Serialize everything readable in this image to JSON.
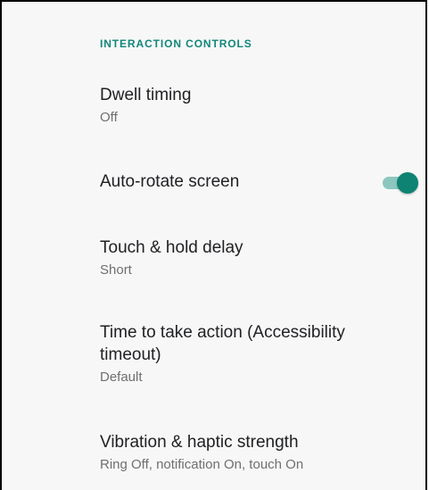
{
  "section": {
    "header": "INTERACTION CONTROLS"
  },
  "preferences": [
    {
      "title": "Dwell timing",
      "summary": "Off"
    },
    {
      "title": "Auto-rotate screen",
      "toggle_on": true
    },
    {
      "title": "Touch & hold delay",
      "summary": "Short"
    },
    {
      "title": "Time to take action (Accessibility timeout)",
      "summary": "Default"
    },
    {
      "title": "Vibration & haptic strength",
      "summary": "Ring Off, notification On, touch On"
    }
  ],
  "colors": {
    "accent": "#0e8373",
    "accent_track": "#8cc7bf",
    "header_text": "#12867a",
    "title_text": "#202124",
    "summary_text": "#6f6f6f",
    "background": "#f7f7f7"
  },
  "icons": {
    "toggle": "switch-on-icon"
  }
}
